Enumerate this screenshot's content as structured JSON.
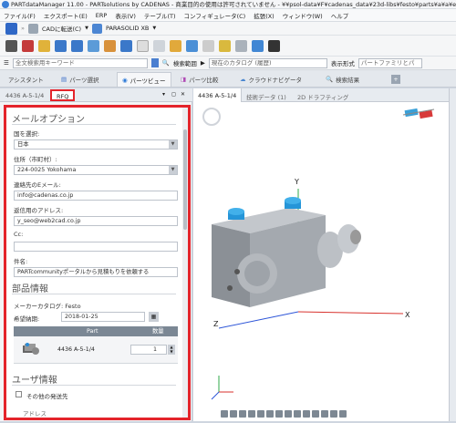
{
  "titlebar": {
    "text": "PARTdataManager 11.00 - PARTsolutions by CADENAS - 商業目的の使用は許可されていません - ¥¥psol-data¥F¥cadenas_data¥23d-libs¥festo¥parts¥a¥a¥e_asmtab.prj"
  },
  "menubar": {
    "items": [
      "ファイル(F)",
      "エクスポート(E)",
      "ERP",
      "表示(V)",
      "テーブル(T)",
      "コンフィギュレータ(C)",
      "拡張(X)",
      "ウィンドウ(W)",
      "ヘルプ"
    ]
  },
  "toolbar1": {
    "cad_label": "CADに転送(C)",
    "cad_target": "PARASOLID XB"
  },
  "searchbar": {
    "placeholder": "全文検索用キーワード",
    "scope_label": "検索範囲",
    "scope_value": "現在のカタログ (履歴)",
    "display_label": "表示形式",
    "display_value": "パートファミリとパ"
  },
  "main_tabs": [
    "アシスタント",
    "パーツ選択",
    "パーツビュー",
    "パーツ比較",
    "クラウドナビゲータ",
    "検索結果"
  ],
  "left_panel": {
    "tabs": [
      "4436 A-5-1/4",
      "RFQ"
    ],
    "mail_section_title": "メールオプション",
    "country_label": "国を選択:",
    "country_value": "日本",
    "address_label": "住所（市町村）:",
    "address_value": "224-0025 Yokohama",
    "contact_email_label": "連絡先のEメール:",
    "contact_email_value": "info@cadenas.co.jp",
    "recipient_label": "返信用のアドレス:",
    "recipient_value": "y_seo@web2cad.co.jp",
    "cc_label": "Cc:",
    "cc_value": "",
    "subject_label": "件名:",
    "subject_value": "PARTcommunityポータルから見積もりを依頼する",
    "parts_section_title": "部品情報",
    "maker_label": "メーカーカタログ: Festo",
    "date_label": "希望納期:",
    "date_value": "2018-01-25",
    "table_header_part": "Part",
    "table_header_qty": "数量",
    "part_name": "4436 A-5-1/4",
    "qty_value": "1",
    "user_section_title": "ユーザ情報",
    "other_recipient_label": "その他の発送先",
    "address_bottom_label": "アドレス"
  },
  "right_panel": {
    "tabs": [
      "4436 A-5-1/4",
      "技術データ (1)",
      "2D ドラフティング"
    ],
    "axis_y": "Y",
    "axis_x": "X",
    "axis_z": "Z"
  }
}
